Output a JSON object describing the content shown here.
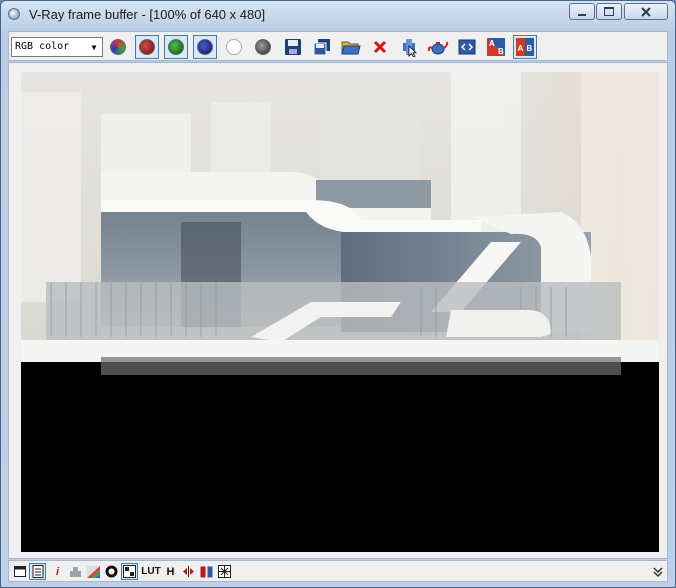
{
  "window": {
    "title": "V-Ray frame buffer - [100% of 640 x 480]"
  },
  "toolbar": {
    "channel_select": {
      "value": "RGB color"
    },
    "buttons": [
      {
        "icon": "rgb-channel-icon"
      },
      {
        "icon": "red-channel-icon",
        "pressed": true
      },
      {
        "icon": "green-channel-icon",
        "pressed": true
      },
      {
        "icon": "blue-channel-icon",
        "pressed": true
      },
      {
        "icon": "alpha-channel-icon"
      },
      {
        "icon": "monochrome-icon"
      },
      {
        "icon": "save-icon"
      },
      {
        "icon": "save-all-icon"
      },
      {
        "icon": "load-icon"
      },
      {
        "icon": "clear-icon"
      },
      {
        "icon": "track-mouse-icon"
      },
      {
        "icon": "render-teapot-icon"
      },
      {
        "icon": "region-render-icon"
      },
      {
        "icon": "ab-compare-horizontal-icon"
      },
      {
        "icon": "ab-compare-vertical-icon",
        "pressed": true
      }
    ]
  },
  "statusbar": {
    "lut_label": "LUT",
    "h_label": "H",
    "info_label": "i"
  },
  "colors": {
    "titlebar": "#c9d9ee",
    "toolbar_bg": "#f0f0f0",
    "render_bg": "#000000",
    "pressed_border": "#3c7fb1"
  }
}
